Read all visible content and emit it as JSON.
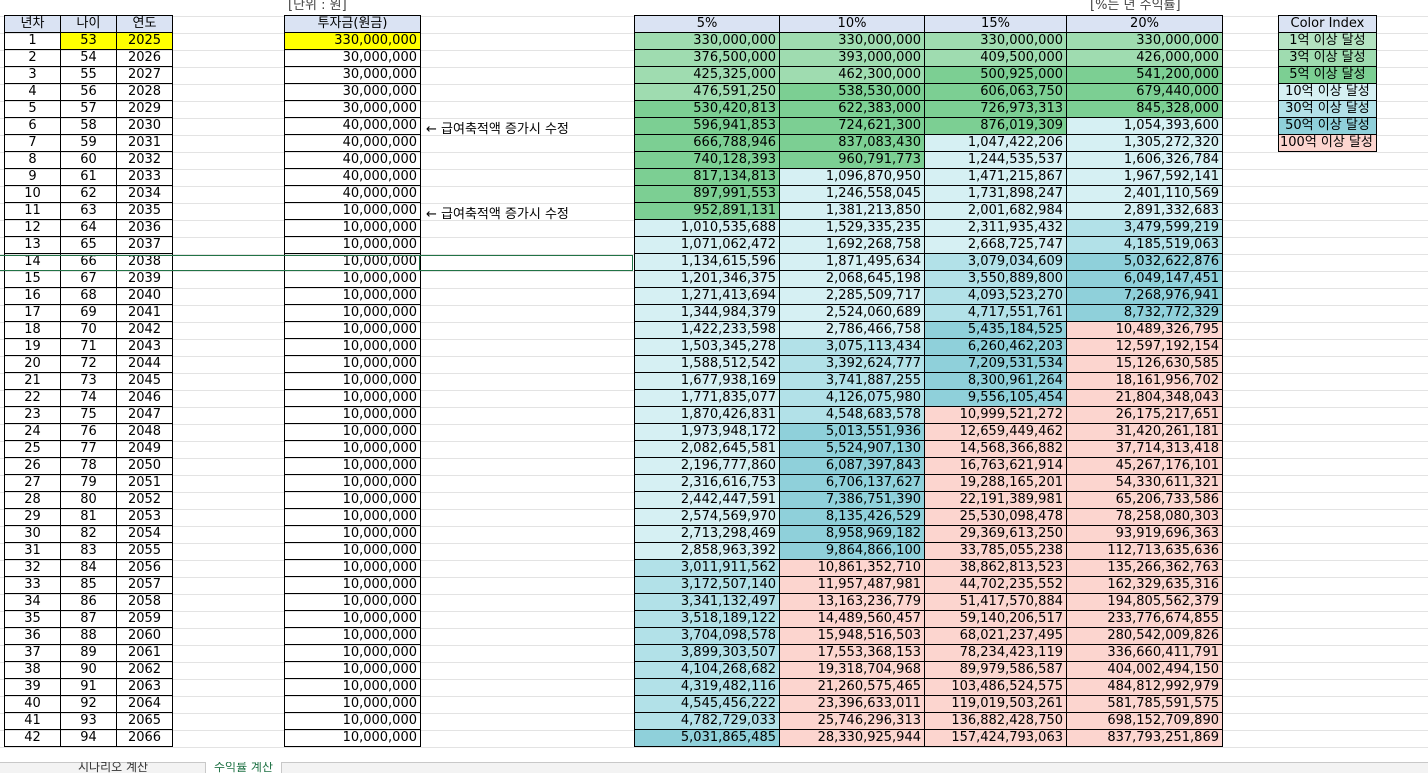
{
  "unit_label": "[단위 : 원]",
  "rate_label": "[%는 년 수익률]",
  "note_text": "← 급여축적액 증가시 수정",
  "headers": {
    "year_no": "년차",
    "age": "나이",
    "year": "연도",
    "investment": "투자금(원금)"
  },
  "rate_headers": [
    "5%",
    "10%",
    "15%",
    "20%"
  ],
  "color_index": {
    "title": "Color Index",
    "items": [
      {
        "label": "1억 이상 달성",
        "color": "#b4e3c1"
      },
      {
        "label": "3억 이상 달성",
        "color": "#9fdcb0"
      },
      {
        "label": "5억 이상 달성",
        "color": "#7ccf93"
      },
      {
        "label": "10억 이상 달성",
        "color": "#d6f0f3"
      },
      {
        "label": "30억 이상 달성",
        "color": "#b2e1e8"
      },
      {
        "label": "50억 이상 달성",
        "color": "#8fd0da"
      },
      {
        "label": "100억 이상 달성",
        "color": "#fcd5cf"
      }
    ]
  },
  "tabs": [
    "시나리오 계산",
    "수익률 계산"
  ],
  "rows": [
    [
      "1",
      "53",
      "2025",
      "330,000,000",
      "330,000,000",
      "330,000,000",
      "330,000,000",
      "330,000,000"
    ],
    [
      "2",
      "54",
      "2026",
      "30,000,000",
      "376,500,000",
      "393,000,000",
      "409,500,000",
      "426,000,000"
    ],
    [
      "3",
      "55",
      "2027",
      "30,000,000",
      "425,325,000",
      "462,300,000",
      "500,925,000",
      "541,200,000"
    ],
    [
      "4",
      "56",
      "2028",
      "30,000,000",
      "476,591,250",
      "538,530,000",
      "606,063,750",
      "679,440,000"
    ],
    [
      "5",
      "57",
      "2029",
      "30,000,000",
      "530,420,813",
      "622,383,000",
      "726,973,313",
      "845,328,000"
    ],
    [
      "6",
      "58",
      "2030",
      "40,000,000",
      "596,941,853",
      "724,621,300",
      "876,019,309",
      "1,054,393,600"
    ],
    [
      "7",
      "59",
      "2031",
      "40,000,000",
      "666,788,946",
      "837,083,430",
      "1,047,422,206",
      "1,305,272,320"
    ],
    [
      "8",
      "60",
      "2032",
      "40,000,000",
      "740,128,393",
      "960,791,773",
      "1,244,535,537",
      "1,606,326,784"
    ],
    [
      "9",
      "61",
      "2033",
      "40,000,000",
      "817,134,813",
      "1,096,870,950",
      "1,471,215,867",
      "1,967,592,141"
    ],
    [
      "10",
      "62",
      "2034",
      "40,000,000",
      "897,991,553",
      "1,246,558,045",
      "1,731,898,247",
      "2,401,110,569"
    ],
    [
      "11",
      "63",
      "2035",
      "10,000,000",
      "952,891,131",
      "1,381,213,850",
      "2,001,682,984",
      "2,891,332,683"
    ],
    [
      "12",
      "64",
      "2036",
      "10,000,000",
      "1,010,535,688",
      "1,529,335,235",
      "2,311,935,432",
      "3,479,599,219"
    ],
    [
      "13",
      "65",
      "2037",
      "10,000,000",
      "1,071,062,472",
      "1,692,268,758",
      "2,668,725,747",
      "4,185,519,063"
    ],
    [
      "14",
      "66",
      "2038",
      "10,000,000",
      "1,134,615,596",
      "1,871,495,634",
      "3,079,034,609",
      "5,032,622,876"
    ],
    [
      "15",
      "67",
      "2039",
      "10,000,000",
      "1,201,346,375",
      "2,068,645,198",
      "3,550,889,800",
      "6,049,147,451"
    ],
    [
      "16",
      "68",
      "2040",
      "10,000,000",
      "1,271,413,694",
      "2,285,509,717",
      "4,093,523,270",
      "7,268,976,941"
    ],
    [
      "17",
      "69",
      "2041",
      "10,000,000",
      "1,344,984,379",
      "2,524,060,689",
      "4,717,551,761",
      "8,732,772,329"
    ],
    [
      "18",
      "70",
      "2042",
      "10,000,000",
      "1,422,233,598",
      "2,786,466,758",
      "5,435,184,525",
      "10,489,326,795"
    ],
    [
      "19",
      "71",
      "2043",
      "10,000,000",
      "1,503,345,278",
      "3,075,113,434",
      "6,260,462,203",
      "12,597,192,154"
    ],
    [
      "20",
      "72",
      "2044",
      "10,000,000",
      "1,588,512,542",
      "3,392,624,777",
      "7,209,531,534",
      "15,126,630,585"
    ],
    [
      "21",
      "73",
      "2045",
      "10,000,000",
      "1,677,938,169",
      "3,741,887,255",
      "8,300,961,264",
      "18,161,956,702"
    ],
    [
      "22",
      "74",
      "2046",
      "10,000,000",
      "1,771,835,077",
      "4,126,075,980",
      "9,556,105,454",
      "21,804,348,043"
    ],
    [
      "23",
      "75",
      "2047",
      "10,000,000",
      "1,870,426,831",
      "4,548,683,578",
      "10,999,521,272",
      "26,175,217,651"
    ],
    [
      "24",
      "76",
      "2048",
      "10,000,000",
      "1,973,948,172",
      "5,013,551,936",
      "12,659,449,462",
      "31,420,261,181"
    ],
    [
      "25",
      "77",
      "2049",
      "10,000,000",
      "2,082,645,581",
      "5,524,907,130",
      "14,568,366,882",
      "37,714,313,418"
    ],
    [
      "26",
      "78",
      "2050",
      "10,000,000",
      "2,196,777,860",
      "6,087,397,843",
      "16,763,621,914",
      "45,267,176,101"
    ],
    [
      "27",
      "79",
      "2051",
      "10,000,000",
      "2,316,616,753",
      "6,706,137,627",
      "19,288,165,201",
      "54,330,611,321"
    ],
    [
      "28",
      "80",
      "2052",
      "10,000,000",
      "2,442,447,591",
      "7,386,751,390",
      "22,191,389,981",
      "65,206,733,586"
    ],
    [
      "29",
      "81",
      "2053",
      "10,000,000",
      "2,574,569,970",
      "8,135,426,529",
      "25,530,098,478",
      "78,258,080,303"
    ],
    [
      "30",
      "82",
      "2054",
      "10,000,000",
      "2,713,298,469",
      "8,958,969,182",
      "29,369,613,250",
      "93,919,696,363"
    ],
    [
      "31",
      "83",
      "2055",
      "10,000,000",
      "2,858,963,392",
      "9,864,866,100",
      "33,785,055,238",
      "112,713,635,636"
    ],
    [
      "32",
      "84",
      "2056",
      "10,000,000",
      "3,011,911,562",
      "10,861,352,710",
      "38,862,813,523",
      "135,266,362,763"
    ],
    [
      "33",
      "85",
      "2057",
      "10,000,000",
      "3,172,507,140",
      "11,957,487,981",
      "44,702,235,552",
      "162,329,635,316"
    ],
    [
      "34",
      "86",
      "2058",
      "10,000,000",
      "3,341,132,497",
      "13,163,236,779",
      "51,417,570,884",
      "194,805,562,379"
    ],
    [
      "35",
      "87",
      "2059",
      "10,000,000",
      "3,518,189,122",
      "14,489,560,457",
      "59,140,206,517",
      "233,776,674,855"
    ],
    [
      "36",
      "88",
      "2060",
      "10,000,000",
      "3,704,098,578",
      "15,948,516,503",
      "68,021,237,495",
      "280,542,009,826"
    ],
    [
      "37",
      "89",
      "2061",
      "10,000,000",
      "3,899,303,507",
      "17,553,368,153",
      "78,234,423,119",
      "336,660,411,791"
    ],
    [
      "38",
      "90",
      "2062",
      "10,000,000",
      "4,104,268,682",
      "19,318,704,968",
      "89,979,586,587",
      "404,002,494,150"
    ],
    [
      "39",
      "91",
      "2063",
      "10,000,000",
      "4,319,482,116",
      "21,260,575,465",
      "103,486,524,575",
      "484,812,992,979"
    ],
    [
      "40",
      "92",
      "2064",
      "10,000,000",
      "4,545,456,222",
      "23,396,633,011",
      "119,019,503,261",
      "581,785,591,575"
    ],
    [
      "41",
      "93",
      "2065",
      "10,000,000",
      "4,782,729,033",
      "25,746,296,313",
      "136,882,428,750",
      "698,152,709,890"
    ],
    [
      "42",
      "94",
      "2066",
      "10,000,000",
      "5,031,865,485",
      "28,330,925,944",
      "157,424,793,063",
      "837,793,251,869"
    ]
  ]
}
